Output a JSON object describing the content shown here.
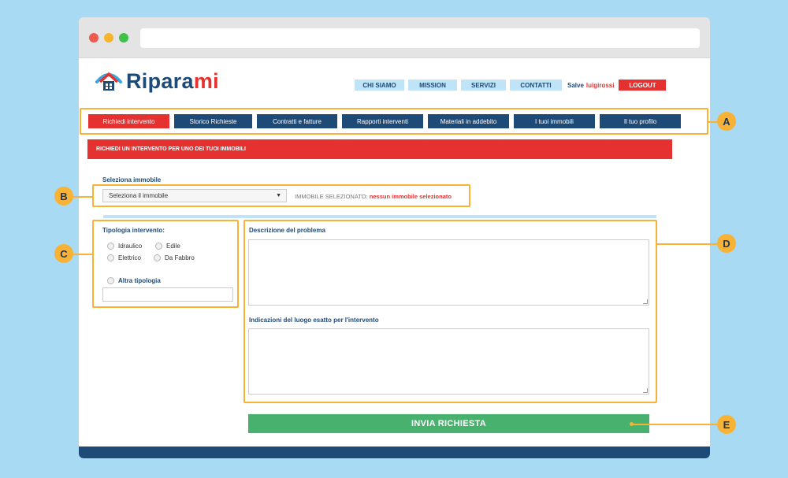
{
  "logo": {
    "text_main": "Ripara",
    "text_accent": "mi"
  },
  "top_nav": {
    "items": [
      {
        "label": "CHI SIAMO"
      },
      {
        "label": "MISSION"
      },
      {
        "label": "SERVIZI"
      },
      {
        "label": "CONTATTI"
      }
    ],
    "greeting": "Salve",
    "username": "luigirossi",
    "logout_label": "LOGOUT"
  },
  "main_nav": {
    "items": [
      {
        "label": "Richiedi intervento",
        "active": true
      },
      {
        "label": "Storico Richieste"
      },
      {
        "label": "Contratti e fatture"
      },
      {
        "label": "Rapporti interventi"
      },
      {
        "label": "Materiali in addebito"
      },
      {
        "label": "I tuoi immobili"
      },
      {
        "label": "Il tuo profilo"
      }
    ]
  },
  "banner": {
    "title": "RICHIEDI UN INTERVENTO PER UNO DEI TUOI IMMOBILI"
  },
  "property": {
    "label": "Seleziona immobile",
    "select_value": "Seleziona il immobile",
    "status_prefix": "IMMOBILE SELEZIONATO:",
    "status_value": "nessun immobile selezionato"
  },
  "type": {
    "label": "Tipologia intervento:",
    "options": [
      "Idraulico",
      "Edile",
      "Elettrico",
      "Da Fabbro"
    ],
    "other_label": "Altra tipologia",
    "other_value": ""
  },
  "description": {
    "label": "Descrizione del problema",
    "value": ""
  },
  "location": {
    "label": "Indicazioni del luogo esatto per l'intervento",
    "value": ""
  },
  "submit": {
    "label": "INVIA RICHIESTA"
  },
  "callouts": {
    "a": "A",
    "b": "B",
    "c": "C",
    "d": "D",
    "e": "E"
  },
  "colors": {
    "brand_blue": "#1e4a78",
    "accent_red": "#e63131",
    "submit_green": "#48b16e",
    "highlight_orange": "#f8b236",
    "page_background": "#a9daf3"
  }
}
